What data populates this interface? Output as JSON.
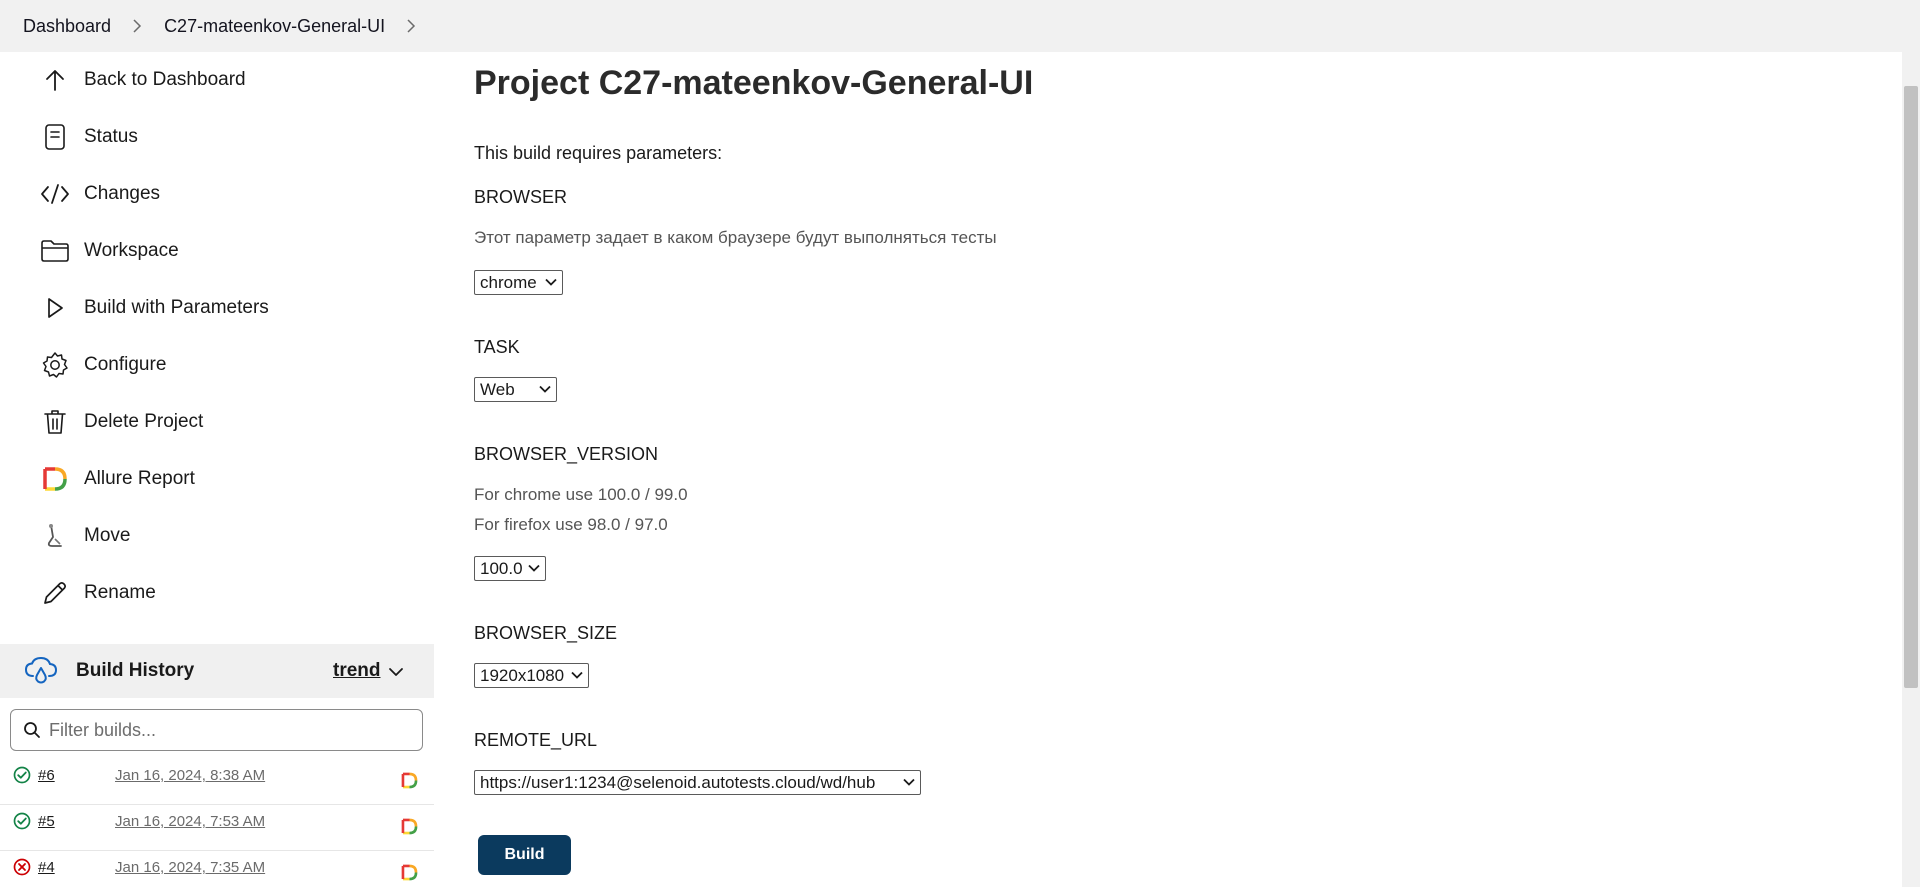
{
  "breadcrumb": {
    "items": [
      "Dashboard",
      "C27-mateenkov-General-UI"
    ]
  },
  "sidebar": {
    "items": [
      {
        "label": "Back to Dashboard",
        "icon": "arrow-up-icon"
      },
      {
        "label": "Status",
        "icon": "document-icon"
      },
      {
        "label": "Changes",
        "icon": "code-icon"
      },
      {
        "label": "Workspace",
        "icon": "folder-icon"
      },
      {
        "label": "Build with Parameters",
        "icon": "play-icon"
      },
      {
        "label": "Configure",
        "icon": "gear-icon"
      },
      {
        "label": "Delete Project",
        "icon": "trash-icon"
      },
      {
        "label": "Allure Report",
        "icon": "allure-icon"
      },
      {
        "label": "Move",
        "icon": "move-icon"
      },
      {
        "label": "Rename",
        "icon": "pencil-icon"
      }
    ]
  },
  "build_history": {
    "title": "Build History",
    "trend_label": "trend",
    "filter_placeholder": "Filter builds...",
    "builds": [
      {
        "number": "#6",
        "date": "Jan 16, 2024, 8:38 AM",
        "status": "success"
      },
      {
        "number": "#5",
        "date": "Jan 16, 2024, 7:53 AM",
        "status": "success"
      },
      {
        "number": "#4",
        "date": "Jan 16, 2024, 7:35 AM",
        "status": "failed"
      }
    ]
  },
  "main": {
    "title": "Project C27-mateenkov-General-UI",
    "intro": "This build requires parameters:",
    "params": {
      "browser": {
        "name": "BROWSER",
        "description": "Этот параметр задает в каком браузере будут выполняться тесты",
        "value": "chrome"
      },
      "task": {
        "name": "TASK",
        "value": "Web"
      },
      "browser_version": {
        "name": "BROWSER_VERSION",
        "description_line1": "For chrome use 100.0 / 99.0",
        "description_line2": "For firefox use  98.0 / 97.0",
        "value": "100.0"
      },
      "browser_size": {
        "name": "BROWSER_SIZE",
        "value": "1920x1080"
      },
      "remote_url": {
        "name": "REMOTE_URL",
        "value": "https://user1:1234@selenoid.autotests.cloud/wd/hub"
      }
    },
    "build_button": "Build"
  },
  "colors": {
    "topbar_bg": "#f1f1f1",
    "build_button_bg": "#0b3a5e",
    "success": "#138347",
    "failed": "#cc0003",
    "history_header_bg": "#f0f0f0"
  }
}
